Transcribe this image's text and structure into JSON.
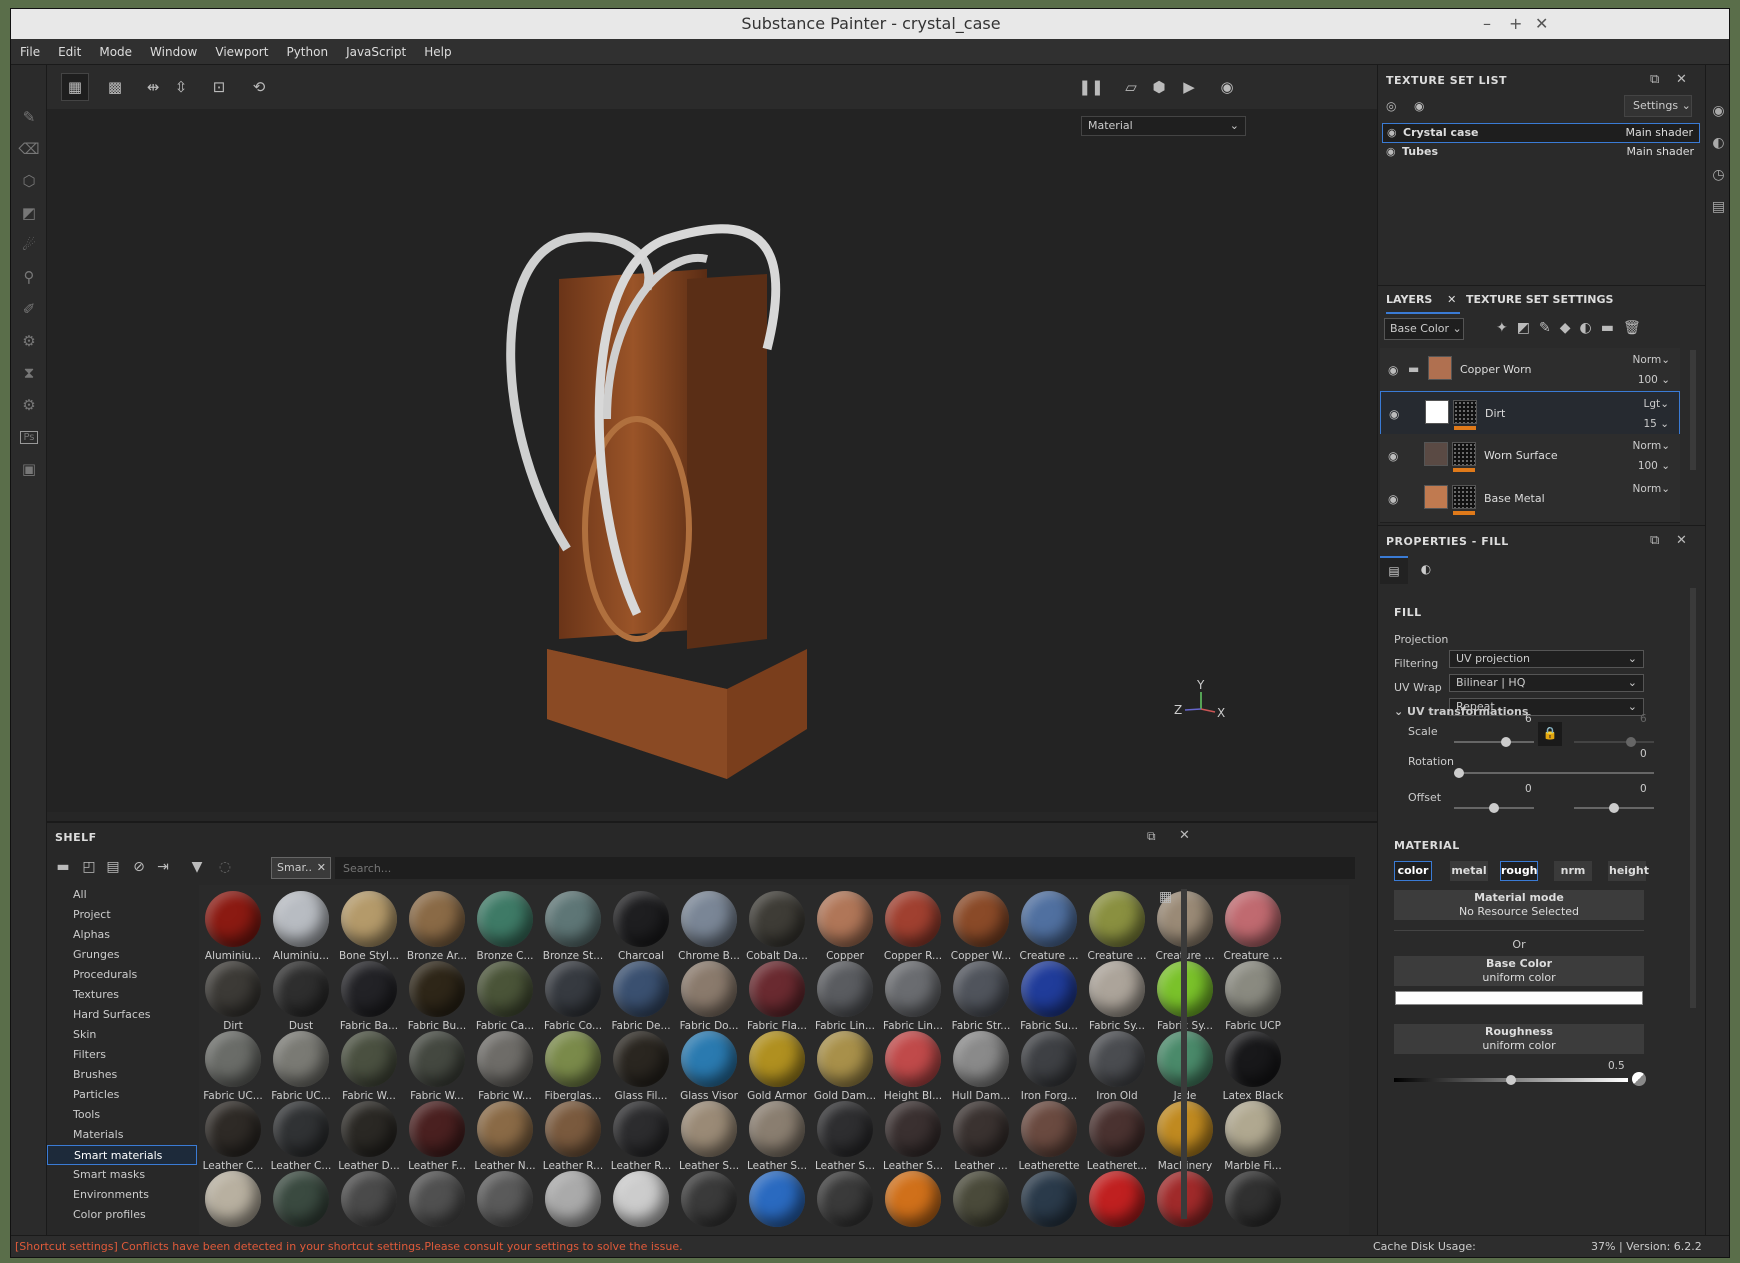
{
  "window": {
    "title": "Substance Painter - crystal_case"
  },
  "menu": [
    "File",
    "Edit",
    "Mode",
    "Window",
    "Viewport",
    "Python",
    "JavaScript",
    "Help"
  ],
  "viewport": {
    "material_dropdown": "Material",
    "axis_labels": {
      "x": "X",
      "y": "Y",
      "z": "Z"
    }
  },
  "shelf": {
    "title": "SHELF",
    "filter_tag": "Smar..",
    "search_placeholder": "Search...",
    "categories": [
      "All",
      "Project",
      "Alphas",
      "Grunges",
      "Procedurals",
      "Textures",
      "Hard Surfaces",
      "Skin",
      "Filters",
      "Brushes",
      "Particles",
      "Tools",
      "Materials",
      "Smart materials",
      "Smart masks",
      "Environments",
      "Color profiles"
    ],
    "selected_category": "Smart materials",
    "items": [
      {
        "label": "Aluminiu...",
        "color": "#8b1a12"
      },
      {
        "label": "Aluminiu...",
        "color": "#b8bcc2"
      },
      {
        "label": "Bone Styl...",
        "color": "#b49a6a"
      },
      {
        "label": "Bronze Ar...",
        "color": "#8a6a46"
      },
      {
        "label": "Bronze C...",
        "color": "#3e7a66"
      },
      {
        "label": "Bronze St...",
        "color": "#5e7676"
      },
      {
        "label": "Charcoal",
        "color": "#1e1e20"
      },
      {
        "label": "Chrome B...",
        "color": "#7a8696"
      },
      {
        "label": "Cobalt Da...",
        "color": "#3e3c36"
      },
      {
        "label": "Copper",
        "color": "#b07658"
      },
      {
        "label": "Copper R...",
        "color": "#a04030"
      },
      {
        "label": "Copper W...",
        "color": "#8a4a28"
      },
      {
        "label": "Creature ...",
        "color": "#5070a0"
      },
      {
        "label": "Creature ...",
        "color": "#8a9040"
      },
      {
        "label": "Creature ...",
        "color": "#9a8a76"
      },
      {
        "label": "Creature ...",
        "color": "#c06a70"
      },
      {
        "label": "Dirt",
        "color": "#3c3a36"
      },
      {
        "label": "Dust",
        "color": "#2e2e2e"
      },
      {
        "label": "Fabric Ba...",
        "color": "#222226"
      },
      {
        "label": "Fabric Bu...",
        "color": "#2e2618"
      },
      {
        "label": "Fabric Ca...",
        "color": "#4a5438"
      },
      {
        "label": "Fabric Co...",
        "color": "#363a40"
      },
      {
        "label": "Fabric De...",
        "color": "#3a5070"
      },
      {
        "label": "Fabric Do...",
        "color": "#8a7a6c"
      },
      {
        "label": "Fabric Fla...",
        "color": "#6a2a30"
      },
      {
        "label": "Fabric Lin...",
        "color": "#5a5c60"
      },
      {
        "label": "Fabric Lin...",
        "color": "#6a6c70"
      },
      {
        "label": "Fabric Str...",
        "color": "#50545c"
      },
      {
        "label": "Fabric Su...",
        "color": "#203c9a"
      },
      {
        "label": "Fabric Sy...",
        "color": "#aca49a"
      },
      {
        "label": "Fabric Sy...",
        "color": "#7ac22a"
      },
      {
        "label": "Fabric UCP",
        "color": "#8a8a80"
      },
      {
        "label": "Fabric UC...",
        "color": "#6a6c68"
      },
      {
        "label": "Fabric UC...",
        "color": "#7a7a74"
      },
      {
        "label": "Fabric W...",
        "color": "#4a5040"
      },
      {
        "label": "Fabric W...",
        "color": "#444840"
      },
      {
        "label": "Fabric W...",
        "color": "#6e6c68"
      },
      {
        "label": "Fiberglas...",
        "color": "#7a8a4a"
      },
      {
        "label": "Glass Fil...",
        "color": "#2a2620"
      },
      {
        "label": "Glass Visor",
        "color": "#2a7ab0"
      },
      {
        "label": "Gold Armor",
        "color": "#b09020"
      },
      {
        "label": "Gold Dam...",
        "color": "#a8904a"
      },
      {
        "label": "Height Bl...",
        "color": "#c04a4a"
      },
      {
        "label": "Hull Dam...",
        "color": "#8a8a8a"
      },
      {
        "label": "Iron Forg...",
        "color": "#3e4044"
      },
      {
        "label": "Iron Old",
        "color": "#4a4c50"
      },
      {
        "label": "Jade",
        "color": "#4a8a6a"
      },
      {
        "label": "Latex Black",
        "color": "#18181a"
      },
      {
        "label": "Leather C...",
        "color": "#2e2a26"
      },
      {
        "label": "Leather C...",
        "color": "#303234"
      },
      {
        "label": "Leather D...",
        "color": "#2a2824"
      },
      {
        "label": "Leather F...",
        "color": "#4a2020"
      },
      {
        "label": "Leather N...",
        "color": "#8a6a46"
      },
      {
        "label": "Leather R...",
        "color": "#7a5a3e"
      },
      {
        "label": "Leather R...",
        "color": "#2c2c2e"
      },
      {
        "label": "Leather S...",
        "color": "#9a8a76"
      },
      {
        "label": "Leather S...",
        "color": "#8a7e70"
      },
      {
        "label": "Leather S...",
        "color": "#2e2e30"
      },
      {
        "label": "Leather S...",
        "color": "#3a3030"
      },
      {
        "label": "Leather ...",
        "color": "#3a3230"
      },
      {
        "label": "Leatherette",
        "color": "#6a4a40"
      },
      {
        "label": "Leatheret...",
        "color": "#4a3230"
      },
      {
        "label": "Machinery",
        "color": "#c08a20"
      },
      {
        "label": "Marble Fi...",
        "color": "#b0a890"
      },
      {
        "label": "",
        "color": "#b8b0a0"
      },
      {
        "label": "",
        "color": "#3a4a40"
      },
      {
        "label": "",
        "color": "#4a4a4a"
      },
      {
        "label": "",
        "color": "#505050"
      },
      {
        "label": "",
        "color": "#5a5a5a"
      },
      {
        "label": "",
        "color": "#aaaaaa"
      },
      {
        "label": "",
        "color": "#cccccc"
      },
      {
        "label": "",
        "color": "#3a3a3a"
      },
      {
        "label": "",
        "color": "#2a6ac0"
      },
      {
        "label": "",
        "color": "#3a3a3a"
      },
      {
        "label": "",
        "color": "#d0701a"
      },
      {
        "label": "",
        "color": "#4a4a3a"
      },
      {
        "label": "",
        "color": "#2a3a4a"
      },
      {
        "label": "",
        "color": "#c02020"
      },
      {
        "label": "",
        "color": "#a02a2a"
      },
      {
        "label": "",
        "color": "#303030"
      }
    ]
  },
  "texture_set_list": {
    "title": "TEXTURE SET LIST",
    "settings_label": "Settings",
    "sets": [
      {
        "name": "Crystal case",
        "shader": "Main shader"
      },
      {
        "name": "Tubes",
        "shader": "Main shader"
      }
    ]
  },
  "layers_panel": {
    "tab_layers": "LAYERS",
    "tab_texture_settings": "TEXTURE SET SETTINGS",
    "channel": "Base Color",
    "layers": [
      {
        "name": "Copper Worn",
        "blend": "Norm",
        "opacity": "100",
        "thumb": "#b07050"
      },
      {
        "name": "Dirt",
        "blend": "Lgt",
        "opacity": "15",
        "thumb": "#ffffff"
      },
      {
        "name": "Worn Surface",
        "blend": "Norm",
        "opacity": "100",
        "thumb": "#5a4a44"
      },
      {
        "name": "Base Metal",
        "blend": "Norm",
        "opacity": "",
        "thumb": "#c07a50"
      }
    ]
  },
  "properties": {
    "title": "PROPERTIES - FILL",
    "fill_header": "FILL",
    "projection_label": "Projection",
    "projection_value": "UV projection",
    "filtering_label": "Filtering",
    "filtering_value": "Bilinear | HQ",
    "uvwrap_label": "UV Wrap",
    "uvwrap_value": "Repeat",
    "uvtrans_label": "UV transformations",
    "scale_label": "Scale",
    "scale_value": "6",
    "scale_value2": "6",
    "rotation_label": "Rotation",
    "rotation_value": "0",
    "offset_label": "Offset",
    "offset_value": "0",
    "offset_value2": "0",
    "material_header": "MATERIAL",
    "channels": [
      "color",
      "metal",
      "rough",
      "nrm",
      "height"
    ],
    "material_mode_title": "Material mode",
    "material_mode_sub": "No Resource Selected",
    "or_label": "Or",
    "base_color_title": "Base Color",
    "base_color_sub": "uniform color",
    "roughness_title": "Roughness",
    "roughness_sub": "uniform color",
    "roughness_value": "0.5"
  },
  "status": {
    "warning": "[Shortcut settings] Conflicts have been detected in your shortcut settings.Please consult your settings to solve the issue.",
    "cache": "Cache Disk Usage:",
    "version": "37% | Version: 6.2.2"
  },
  "colors": {
    "accent": "#3a7bd5",
    "warning": "#e05a3a",
    "dirt_bar": "#e07a1a"
  }
}
